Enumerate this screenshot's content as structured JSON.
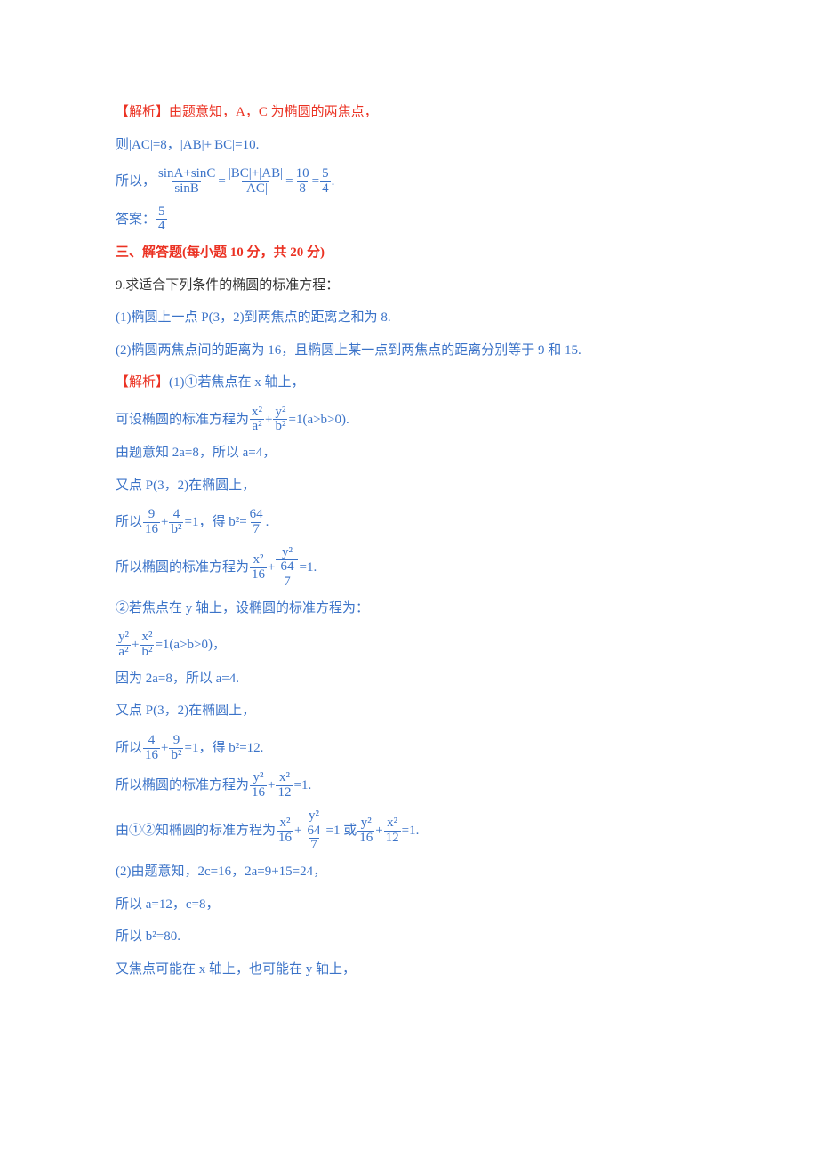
{
  "l1": "【解析】由题意知，A，C 为椭圆的两焦点，",
  "l2": "则|AC|=8，|AB|+|BC|=10.",
  "l3_pre": "所以，",
  "l3_f1_num": "sinA+sinC",
  "l3_f1_den": "sinB",
  "l3_eq1": "=",
  "l3_f2_num": "|BC|+|AB|",
  "l3_f2_den": "|AC|",
  "l3_eq2": "=",
  "l3_f3_num": "10",
  "l3_f3_den": "8",
  "l3_eq3": "=",
  "l3_f4_num": "5",
  "l3_f4_den": "4",
  "l3_post": ".",
  "l4_pre": "答案：",
  "l4_num": "5",
  "l4_den": "4",
  "h3": "三、解答题(每小题 10 分，共 20 分)",
  "l5": "9.求适合下列条件的椭圆的标准方程：",
  "l6": "(1)椭圆上一点 P(3，2)到两焦点的距离之和为 8.",
  "l7": "(2)椭圆两焦点间的距离为 16，且椭圆上某一点到两焦点的距离分别等于 9 和 15.",
  "l8a": "【解析】",
  "l8b": "(1)①若焦点在 x 轴上，",
  "l9_pre": "可设椭圆的标准方程为",
  "l9_f1_num": "x²",
  "l9_f1_den": "a²",
  "l9_plus": "+",
  "l9_f2_num": "y²",
  "l9_f2_den": "b²",
  "l9_post": "=1(a>b>0).",
  "l10": "由题意知 2a=8，所以 a=4，",
  "l11": "又点 P(3，2)在椭圆上，",
  "l12_pre": "所以",
  "l12_f1_num": "9",
  "l12_f1_den": "16",
  "l12_plus": "+",
  "l12_f2_num": "4",
  "l12_f2_den": "b²",
  "l12_mid": "=1，得 b²=",
  "l12_f3_num": "64",
  "l12_f3_den": "7",
  "l12_post": ".",
  "l13_pre": "所以椭圆的标准方程为",
  "l13_f1_num": "x²",
  "l13_f1_den": "16",
  "l13_plus": "+",
  "l13_f2_num": "y²",
  "l13_f2_den_num": "64",
  "l13_f2_den_den": "7",
  "l13_post": "=1.",
  "l14": "②若焦点在 y 轴上，设椭圆的标准方程为：",
  "l15_f1_num": "y²",
  "l15_f1_den": "a²",
  "l15_plus": "+",
  "l15_f2_num": "x²",
  "l15_f2_den": "b²",
  "l15_post": "=1(a>b>0)，",
  "l16": "因为 2a=8，所以 a=4.",
  "l17": "又点 P(3，2)在椭圆上，",
  "l18_pre": "所以",
  "l18_f1_num": "4",
  "l18_f1_den": "16",
  "l18_plus": "+",
  "l18_f2_num": "9",
  "l18_f2_den": "b²",
  "l18_post": "=1，得 b²=12.",
  "l19_pre": "所以椭圆的标准方程为",
  "l19_f1_num": "y²",
  "l19_f1_den": "16",
  "l19_plus": "+",
  "l19_f2_num": "x²",
  "l19_f2_den": "12",
  "l19_post": "=1.",
  "l20_pre": "由①②知椭圆的标准方程为",
  "l20_f1_num": "x²",
  "l20_f1_den": "16",
  "l20_plus1": "+",
  "l20_f2_num": "y²",
  "l20_f2_den_num": "64",
  "l20_f2_den_den": "7",
  "l20_mid": "=1 或",
  "l20_f3_num": "y²",
  "l20_f3_den": "16",
  "l20_plus2": "+",
  "l20_f4_num": "x²",
  "l20_f4_den": "12",
  "l20_post": "=1.",
  "l21": "(2)由题意知，2c=16，2a=9+15=24，",
  "l22": "所以 a=12，c=8，",
  "l23": "所以 b²=80.",
  "l24": "又焦点可能在 x 轴上，也可能在 y 轴上，"
}
